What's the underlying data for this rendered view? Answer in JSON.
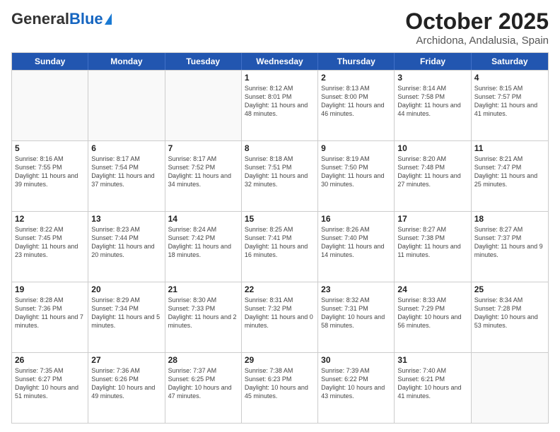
{
  "logo": {
    "general": "General",
    "blue": "Blue"
  },
  "header": {
    "month": "October 2025",
    "location": "Archidona, Andalusia, Spain"
  },
  "weekdays": [
    "Sunday",
    "Monday",
    "Tuesday",
    "Wednesday",
    "Thursday",
    "Friday",
    "Saturday"
  ],
  "weeks": [
    [
      {
        "date": "",
        "sunrise": "",
        "sunset": "",
        "daylight": ""
      },
      {
        "date": "",
        "sunrise": "",
        "sunset": "",
        "daylight": ""
      },
      {
        "date": "",
        "sunrise": "",
        "sunset": "",
        "daylight": ""
      },
      {
        "date": "1",
        "sunrise": "Sunrise: 8:12 AM",
        "sunset": "Sunset: 8:01 PM",
        "daylight": "Daylight: 11 hours and 48 minutes."
      },
      {
        "date": "2",
        "sunrise": "Sunrise: 8:13 AM",
        "sunset": "Sunset: 8:00 PM",
        "daylight": "Daylight: 11 hours and 46 minutes."
      },
      {
        "date": "3",
        "sunrise": "Sunrise: 8:14 AM",
        "sunset": "Sunset: 7:58 PM",
        "daylight": "Daylight: 11 hours and 44 minutes."
      },
      {
        "date": "4",
        "sunrise": "Sunrise: 8:15 AM",
        "sunset": "Sunset: 7:57 PM",
        "daylight": "Daylight: 11 hours and 41 minutes."
      }
    ],
    [
      {
        "date": "5",
        "sunrise": "Sunrise: 8:16 AM",
        "sunset": "Sunset: 7:55 PM",
        "daylight": "Daylight: 11 hours and 39 minutes."
      },
      {
        "date": "6",
        "sunrise": "Sunrise: 8:17 AM",
        "sunset": "Sunset: 7:54 PM",
        "daylight": "Daylight: 11 hours and 37 minutes."
      },
      {
        "date": "7",
        "sunrise": "Sunrise: 8:17 AM",
        "sunset": "Sunset: 7:52 PM",
        "daylight": "Daylight: 11 hours and 34 minutes."
      },
      {
        "date": "8",
        "sunrise": "Sunrise: 8:18 AM",
        "sunset": "Sunset: 7:51 PM",
        "daylight": "Daylight: 11 hours and 32 minutes."
      },
      {
        "date": "9",
        "sunrise": "Sunrise: 8:19 AM",
        "sunset": "Sunset: 7:50 PM",
        "daylight": "Daylight: 11 hours and 30 minutes."
      },
      {
        "date": "10",
        "sunrise": "Sunrise: 8:20 AM",
        "sunset": "Sunset: 7:48 PM",
        "daylight": "Daylight: 11 hours and 27 minutes."
      },
      {
        "date": "11",
        "sunrise": "Sunrise: 8:21 AM",
        "sunset": "Sunset: 7:47 PM",
        "daylight": "Daylight: 11 hours and 25 minutes."
      }
    ],
    [
      {
        "date": "12",
        "sunrise": "Sunrise: 8:22 AM",
        "sunset": "Sunset: 7:45 PM",
        "daylight": "Daylight: 11 hours and 23 minutes."
      },
      {
        "date": "13",
        "sunrise": "Sunrise: 8:23 AM",
        "sunset": "Sunset: 7:44 PM",
        "daylight": "Daylight: 11 hours and 20 minutes."
      },
      {
        "date": "14",
        "sunrise": "Sunrise: 8:24 AM",
        "sunset": "Sunset: 7:42 PM",
        "daylight": "Daylight: 11 hours and 18 minutes."
      },
      {
        "date": "15",
        "sunrise": "Sunrise: 8:25 AM",
        "sunset": "Sunset: 7:41 PM",
        "daylight": "Daylight: 11 hours and 16 minutes."
      },
      {
        "date": "16",
        "sunrise": "Sunrise: 8:26 AM",
        "sunset": "Sunset: 7:40 PM",
        "daylight": "Daylight: 11 hours and 14 minutes."
      },
      {
        "date": "17",
        "sunrise": "Sunrise: 8:27 AM",
        "sunset": "Sunset: 7:38 PM",
        "daylight": "Daylight: 11 hours and 11 minutes."
      },
      {
        "date": "18",
        "sunrise": "Sunrise: 8:27 AM",
        "sunset": "Sunset: 7:37 PM",
        "daylight": "Daylight: 11 hours and 9 minutes."
      }
    ],
    [
      {
        "date": "19",
        "sunrise": "Sunrise: 8:28 AM",
        "sunset": "Sunset: 7:36 PM",
        "daylight": "Daylight: 11 hours and 7 minutes."
      },
      {
        "date": "20",
        "sunrise": "Sunrise: 8:29 AM",
        "sunset": "Sunset: 7:34 PM",
        "daylight": "Daylight: 11 hours and 5 minutes."
      },
      {
        "date": "21",
        "sunrise": "Sunrise: 8:30 AM",
        "sunset": "Sunset: 7:33 PM",
        "daylight": "Daylight: 11 hours and 2 minutes."
      },
      {
        "date": "22",
        "sunrise": "Sunrise: 8:31 AM",
        "sunset": "Sunset: 7:32 PM",
        "daylight": "Daylight: 11 hours and 0 minutes."
      },
      {
        "date": "23",
        "sunrise": "Sunrise: 8:32 AM",
        "sunset": "Sunset: 7:31 PM",
        "daylight": "Daylight: 10 hours and 58 minutes."
      },
      {
        "date": "24",
        "sunrise": "Sunrise: 8:33 AM",
        "sunset": "Sunset: 7:29 PM",
        "daylight": "Daylight: 10 hours and 56 minutes."
      },
      {
        "date": "25",
        "sunrise": "Sunrise: 8:34 AM",
        "sunset": "Sunset: 7:28 PM",
        "daylight": "Daylight: 10 hours and 53 minutes."
      }
    ],
    [
      {
        "date": "26",
        "sunrise": "Sunrise: 7:35 AM",
        "sunset": "Sunset: 6:27 PM",
        "daylight": "Daylight: 10 hours and 51 minutes."
      },
      {
        "date": "27",
        "sunrise": "Sunrise: 7:36 AM",
        "sunset": "Sunset: 6:26 PM",
        "daylight": "Daylight: 10 hours and 49 minutes."
      },
      {
        "date": "28",
        "sunrise": "Sunrise: 7:37 AM",
        "sunset": "Sunset: 6:25 PM",
        "daylight": "Daylight: 10 hours and 47 minutes."
      },
      {
        "date": "29",
        "sunrise": "Sunrise: 7:38 AM",
        "sunset": "Sunset: 6:23 PM",
        "daylight": "Daylight: 10 hours and 45 minutes."
      },
      {
        "date": "30",
        "sunrise": "Sunrise: 7:39 AM",
        "sunset": "Sunset: 6:22 PM",
        "daylight": "Daylight: 10 hours and 43 minutes."
      },
      {
        "date": "31",
        "sunrise": "Sunrise: 7:40 AM",
        "sunset": "Sunset: 6:21 PM",
        "daylight": "Daylight: 10 hours and 41 minutes."
      },
      {
        "date": "",
        "sunrise": "",
        "sunset": "",
        "daylight": ""
      }
    ]
  ]
}
